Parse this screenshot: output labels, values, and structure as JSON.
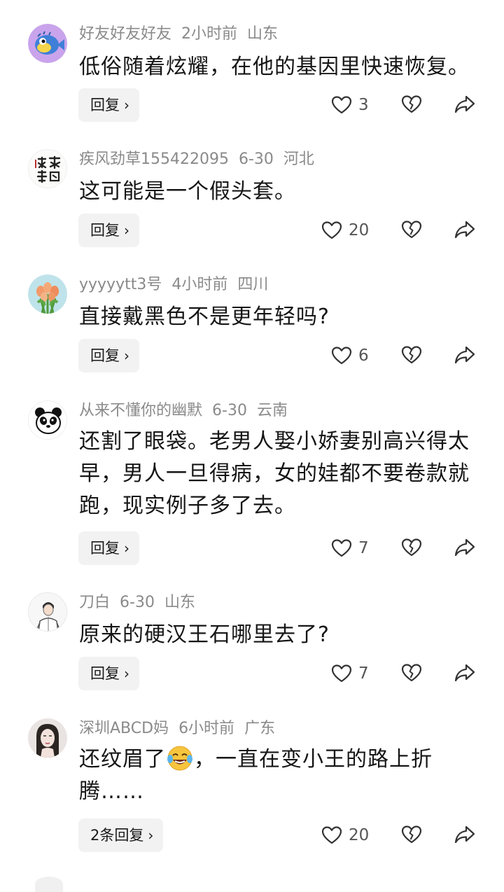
{
  "comments": [
    {
      "username": "好友好友好友",
      "time": "2小时前",
      "location": "山东",
      "text": "低俗随着炫耀，在他的基因里快速恢复。",
      "reply_label": "回复",
      "likes": "3",
      "avatar": "blue-pufferfish-avatar"
    },
    {
      "username": "疾风劲草155422095",
      "time": "6-30",
      "location": "河北",
      "text": "这可能是一个假头套。",
      "reply_label": "回复",
      "likes": "20",
      "avatar": "calligraphy-avatar"
    },
    {
      "username": "yyyyytt3号",
      "time": "4小时前",
      "location": "四川",
      "text": "直接戴黑色不是更年轻吗?",
      "reply_label": "回复",
      "likes": "6",
      "avatar": "tulip-bouquet-avatar"
    },
    {
      "username": "从来不懂你的幽默",
      "time": "6-30",
      "location": "云南",
      "text": "还割了眼袋。老男人娶小娇妻别高兴得太早，男人一旦得病，女的娃都不要卷款就跑，现实例子多了去。",
      "reply_label": "回复",
      "likes": "7",
      "avatar": "panda-avatar"
    },
    {
      "username": "刀白",
      "time": "6-30",
      "location": "山东",
      "text": "原来的硬汉王石哪里去了?",
      "reply_label": "回复",
      "likes": "7",
      "avatar": "man-sketch-avatar"
    },
    {
      "username": "深圳ABCD妈",
      "time": "6小时前",
      "location": "广东",
      "text_before_emoji": "还纹眉了",
      "emoji": "crying-laughing-emoji",
      "text_after_emoji": "，一直在变小王的路上折腾……",
      "reply_label": "2条回复",
      "likes": "20",
      "avatar": "woman-portrait-avatar"
    }
  ],
  "icons": {
    "like": "heart-outline-icon",
    "dislike": "broken-heart-icon",
    "share": "share-arrow-icon",
    "reply_chevron": "chevron-right-icon"
  },
  "chevron": "›",
  "colors": {
    "text_primary": "#161616",
    "text_secondary": "#8a8a8a",
    "button_bg": "#f2f2f2"
  }
}
